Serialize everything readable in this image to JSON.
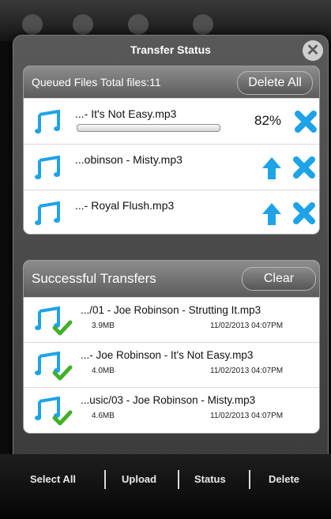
{
  "modal": {
    "title": "Transfer Status",
    "close_icon": "close-icon"
  },
  "queued": {
    "label": "Queued Files Total files:11",
    "delete_all_label": "Delete All",
    "items": [
      {
        "name": "...- It's Not Easy.mp3",
        "progress_label": "82%",
        "progress": 0.82,
        "state": "uploading"
      },
      {
        "name": "...obinson - Misty.mp3",
        "state": "queued"
      },
      {
        "name": "...- Royal Flush.mp3",
        "state": "queued"
      }
    ]
  },
  "successful": {
    "label": "Successful Transfers",
    "clear_label": "Clear",
    "items": [
      {
        "name": ".../01 - Joe Robinson - Strutting It.mp3",
        "size": "3.9MB",
        "date": "11/02/2013 04:07PM"
      },
      {
        "name": "...- Joe Robinson - It's Not Easy.mp3",
        "size": "4.0MB",
        "date": "11/02/2013 04:07PM"
      },
      {
        "name": "...usic/03 - Joe Robinson - Misty.mp3",
        "size": "4.6MB",
        "date": "11/02/2013 04:07PM"
      }
    ]
  },
  "bottom_bar": {
    "select_all": "Select All",
    "upload": "Upload",
    "status": "Status",
    "delete": "Delete"
  },
  "colors": {
    "accent_blue": "#1ea3e8",
    "check_green": "#42b02a",
    "header_gray": "#6e6e6e"
  }
}
